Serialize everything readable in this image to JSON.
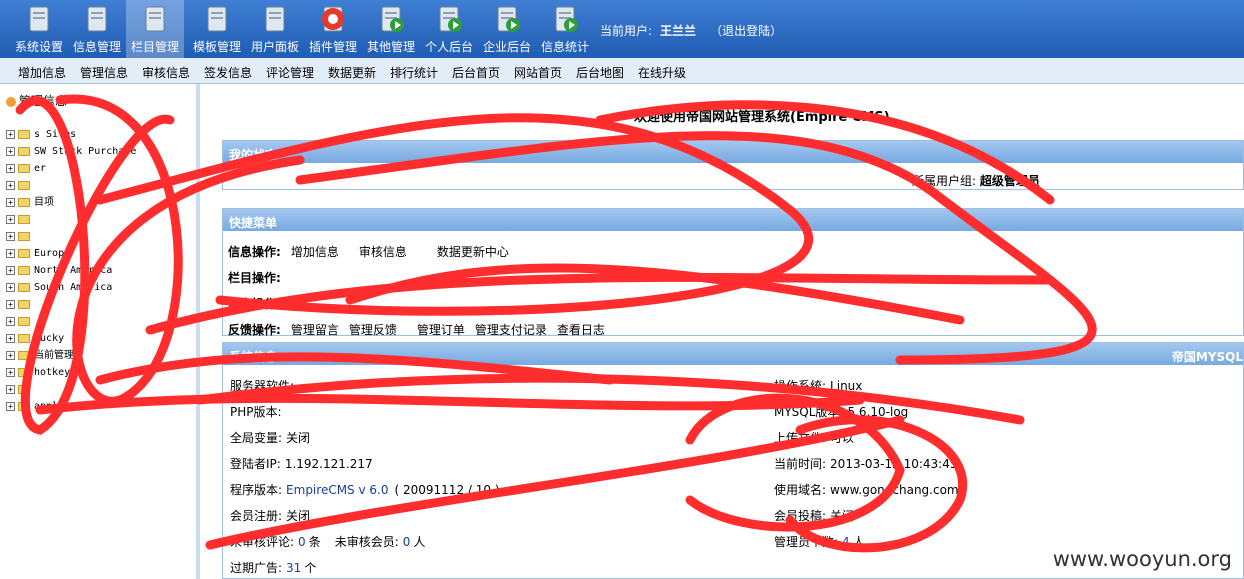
{
  "toolbar": {
    "items": [
      {
        "label": "系统设置",
        "icon": "wrench-icon"
      },
      {
        "label": "信息管理",
        "icon": "documents-icon"
      },
      {
        "label": "栏目管理",
        "icon": "column-icon"
      },
      {
        "label": "模板管理",
        "icon": "template-icon"
      },
      {
        "label": "用户面板",
        "icon": "users-icon"
      },
      {
        "label": "插件管理",
        "icon": "lifebuoy-icon"
      },
      {
        "label": "其他管理",
        "icon": "play-doc-icon"
      },
      {
        "label": "个人后台",
        "icon": "play-doc-icon"
      },
      {
        "label": "企业后台",
        "icon": "play-doc-icon"
      },
      {
        "label": "信息统计",
        "icon": "play-doc-icon"
      }
    ],
    "user_label": "当前用户:",
    "user_name": "王兰兰",
    "logout": "（退出登陆）"
  },
  "menu": [
    "增加信息",
    "管理信息",
    "审核信息",
    "签发信息",
    "评论管理",
    "数据更新",
    "排行统计",
    "后台首页",
    "网站首页",
    "后台地图",
    "在线升级"
  ],
  "tree": {
    "root": "管理信息",
    "nodes": [
      "s Sites",
      "SW Stock Purchase",
      "er",
      "",
      "目项",
      "",
      "",
      "Europe",
      "North America",
      "South America",
      "",
      "",
      "lucky",
      "当前管理",
      "hotkey",
      "",
      "applier"
    ]
  },
  "main": {
    "welcome": "欢迎使用帝国网站管理系统(Empire CMS)",
    "status": {
      "title": "我的状态",
      "group_label": "所属用户组:",
      "group_value": "超级管理员"
    },
    "quick": {
      "title": "快捷菜单",
      "rows": [
        {
          "label": "信息操作:",
          "links": [
            "增加信息",
            "",
            "审核信息",
            "",
            "",
            "数据更新中心"
          ]
        },
        {
          "label": "栏目操作:",
          "links": []
        },
        {
          "label": "用户操作:",
          "links": []
        },
        {
          "label": "反馈操作:",
          "links": [
            "管理留言",
            "管理反馈",
            "",
            "管理订单",
            "管理支付记录",
            "查看日志"
          ]
        }
      ]
    },
    "sysinfo": {
      "title": "系统信息",
      "right_title": "帝国MYSQL",
      "left": [
        {
          "k": "服务器软件:",
          "v": ""
        },
        {
          "k": "PHP版本:",
          "v": ""
        },
        {
          "k": "全局变量:",
          "v": "关闭"
        },
        {
          "k": "登陆者IP:",
          "v": "1.192.121.217"
        },
        {
          "k": "程序版本:",
          "v": "EmpireCMS v 6.0",
          "extra": "( 20091112 / 10 )"
        },
        {
          "k": "会员注册:",
          "v": "关闭"
        },
        {
          "k": "未审核评论:",
          "v": "0",
          "unit": "条",
          "k2": "未审核会员:",
          "v2": "0",
          "unit2": "人"
        },
        {
          "k": "过期广告:",
          "v": "31",
          "unit": "个"
        }
      ],
      "right": [
        {
          "k": "操作系统:",
          "v": "Linux"
        },
        {
          "k": "MYSQL版本:",
          "v": "5.6.10-log"
        },
        {
          "k": "上传文件:",
          "v": "可以"
        },
        {
          "k": "当前时间:",
          "v": "2013-03-12 10:43:45"
        },
        {
          "k": "使用域名:",
          "v": "www.gongchang.com"
        },
        {
          "k": "会员投稿:",
          "v": "关闭"
        },
        {
          "k": "管理员个数:",
          "v": "4",
          "unit": "人"
        }
      ]
    }
  },
  "watermark": "www.wooyun.org",
  "scribble_color": "#ff2d2d"
}
